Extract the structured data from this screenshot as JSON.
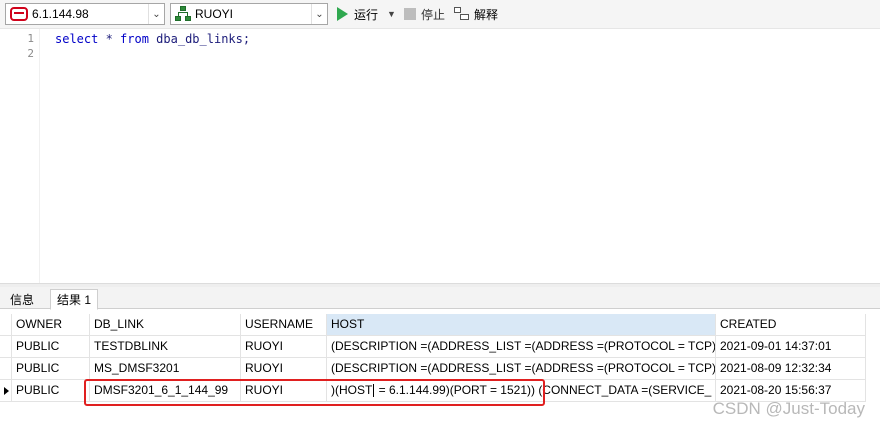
{
  "toolbar": {
    "connection": "6.1.144.98",
    "database": "RUOYI",
    "run_label": "运行",
    "run_dropdown": "▼",
    "stop_label": "停止",
    "explain_label": "解释"
  },
  "editor": {
    "line_numbers": [
      "1",
      "2"
    ],
    "sql": {
      "kw1": "select",
      "star": " * ",
      "kw2": "from",
      "rest": " dba_db_links;"
    }
  },
  "tabs": {
    "info": "信息",
    "result": "结果 1"
  },
  "grid": {
    "columns": [
      "OWNER",
      "DB_LINK",
      "USERNAME",
      "HOST",
      "CREATED"
    ],
    "rows": [
      [
        "PUBLIC",
        "TESTDBLINK",
        "RUOYI",
        "(DESCRIPTION =(ADDRESS_LIST =(ADDRESS =(PROTOCOL = TCP)",
        "2021-09-01 14:37:01"
      ],
      [
        "PUBLIC",
        "MS_DMSF3201",
        "RUOYI",
        "(DESCRIPTION =(ADDRESS_LIST =(ADDRESS =(PROTOCOL = TCP)",
        "2021-08-09 12:32:34"
      ],
      [
        "PUBLIC",
        "DMSF3201_6_1_144_99",
        "RUOYI",
        ")(HOST",
        "2021-08-20 15:56:37"
      ]
    ],
    "host_row3_after_caret": " = 6.1.144.99)(PORT = 1521)) (CONNECT_DATA =(SERVICE_"
  },
  "watermark": "CSDN @Just-Today",
  "colors": {
    "highlight_border": "#e02020",
    "sorted_header": "#d9e8f6",
    "run_green": "#2fa84f"
  }
}
